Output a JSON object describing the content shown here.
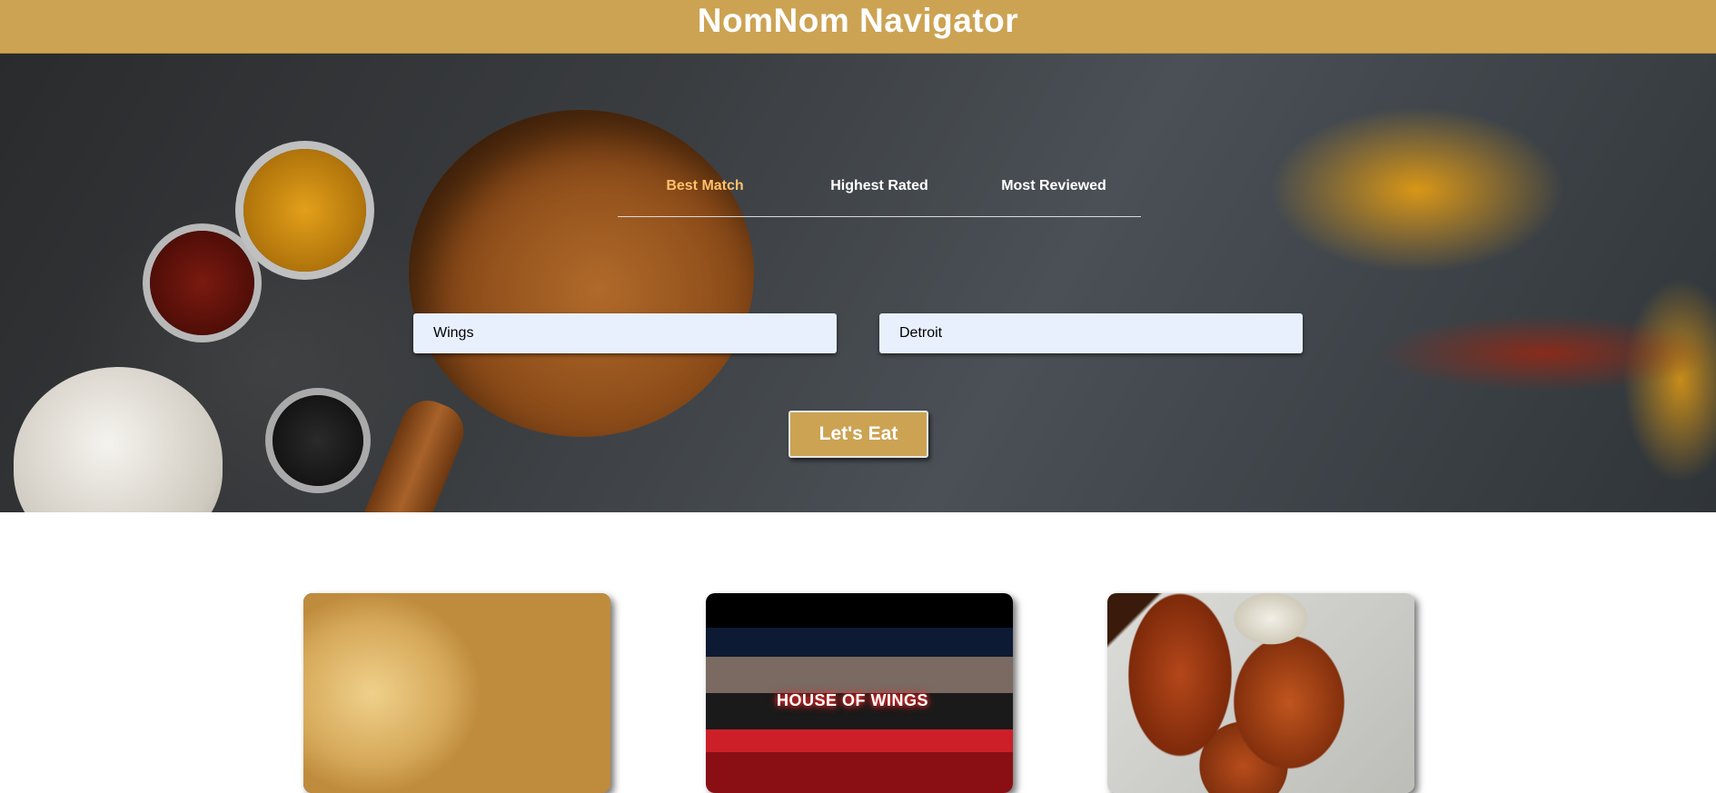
{
  "header": {
    "title": "NomNom Navigator"
  },
  "sort_tabs": [
    {
      "label": "Best Match",
      "active": true
    },
    {
      "label": "Highest Rated",
      "active": false
    },
    {
      "label": "Most Reviewed",
      "active": false
    }
  ],
  "search": {
    "term_value": "Wings",
    "location_value": "Detroit"
  },
  "submit": {
    "label": "Let's Eat"
  },
  "results": [
    {
      "image": "mac-and-cheese-with-wings"
    },
    {
      "image": "house-of-wings-storefront",
      "sign_text": "HOUSE OF WINGS"
    },
    {
      "image": "buffalo-wings-with-dip"
    }
  ],
  "colors": {
    "accent": "#cca353",
    "active_tab": "#ffc16b",
    "input_bg": "#e8f0fe"
  }
}
